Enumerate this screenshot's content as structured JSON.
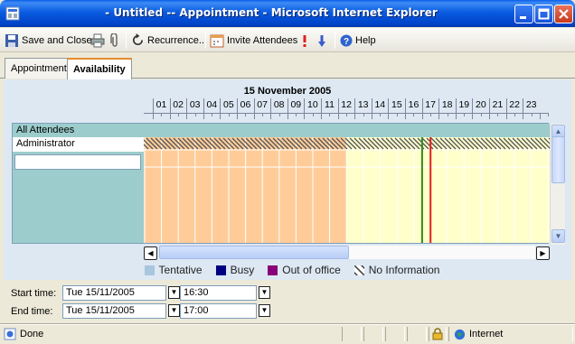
{
  "window": {
    "title": "- Untitled -- Appointment - Microsoft Internet Explorer"
  },
  "toolbar": {
    "save_close": "Save and Close",
    "recurrence": "Recurrence...",
    "invite": "Invite Attendees",
    "help": "Help"
  },
  "tabs": [
    "Appointment",
    "Availability"
  ],
  "schedule": {
    "date": "15 November 2005",
    "hours": [
      "01",
      "02",
      "03",
      "04",
      "05",
      "06",
      "07",
      "08",
      "09",
      "10",
      "11",
      "12",
      "13",
      "14",
      "15",
      "16",
      "17",
      "18",
      "19",
      "20",
      "21",
      "22",
      "23"
    ],
    "all_attendees": "All Attendees",
    "attendees": [
      "Administrator"
    ],
    "new_attendee": "",
    "start_marker_hour": 16.5,
    "end_marker_hour": 17.0,
    "free_from_hour": 12,
    "colors": {
      "out_of_office_block": "#ffcc99",
      "free": "#ffffcc",
      "start_line": "#2e8b1f",
      "end_line": "#e02020",
      "tentative": "#a8c6dd",
      "busy": "#00007f",
      "out_of_office": "#8b0075"
    }
  },
  "legend": [
    {
      "label": "Tentative",
      "color": "#a8c6dd"
    },
    {
      "label": "Busy",
      "color": "#000080"
    },
    {
      "label": "Out of office",
      "color": "#880077"
    },
    {
      "label": "No Information",
      "color": "hatch"
    }
  ],
  "form": {
    "start_label": "Start time:",
    "start_date": "Tue 15/11/2005",
    "start_time": "16:30",
    "end_label": "End time:",
    "end_date": "Tue 15/11/2005",
    "end_time": "17:00"
  },
  "status": {
    "left": "Done",
    "zone": "Internet"
  }
}
